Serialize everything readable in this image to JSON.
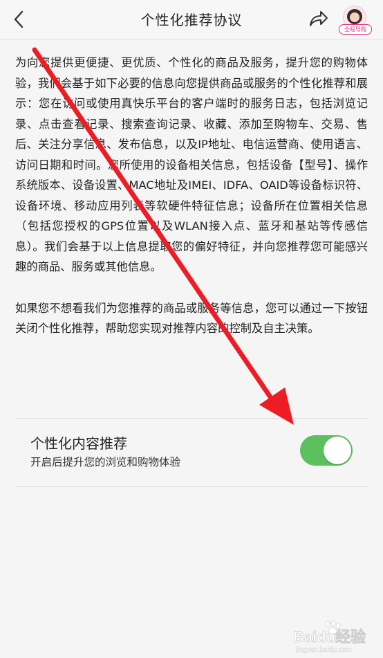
{
  "header": {
    "title": "个性化推荐协议",
    "back_icon": "chevron-left-icon",
    "share_icon": "share-icon",
    "guide_label": "全程导购"
  },
  "content": {
    "paragraph1": "为向您提供更便捷、更优质、个性化的商品及服务，提升您的购物体验，我们会基于如下必要的信息向您提供商品或服务的个性化推荐和展示：您在访问或使用真快乐平台的客户端时的服务日志，包括浏览记录、点击查看记录、搜索查询记录、收藏、添加至购物车、交易、售后、关注分享信息、发布信息，以及IP地址、电信运营商、使用语言、访问日期和时间。您所使用的设备相关信息，包括设备【型号】、操作系统版本、设备设置、MAC地址及IMEI、IDFA、OAID等设备标识符、设备环境、移动应用列表等软硬件特征信息；设备所在位置相关信息（包括您授权的GPS位置以及WLAN接入点、蓝牙和基站等传感信息）。我们会基于以上信息提取您的偏好特征，并向您推荐您可能感兴趣的商品、服务或其他信息。",
    "paragraph2": "如果您不想看我们为您推荐的商品或服务等信息，您可以通过一下按钮关闭个性化推荐，帮助您实现对推荐内容的控制及自主决策。"
  },
  "setting": {
    "title": "个性化内容推荐",
    "description": "开启后提升您的浏览和购物体验",
    "enabled": true,
    "toggle_color": "#5cc05e"
  },
  "annotation": {
    "arrow_color": "#ee1c25"
  },
  "watermark": {
    "text": "Baidu经验",
    "url_text": "jingyan.baidu.com"
  }
}
